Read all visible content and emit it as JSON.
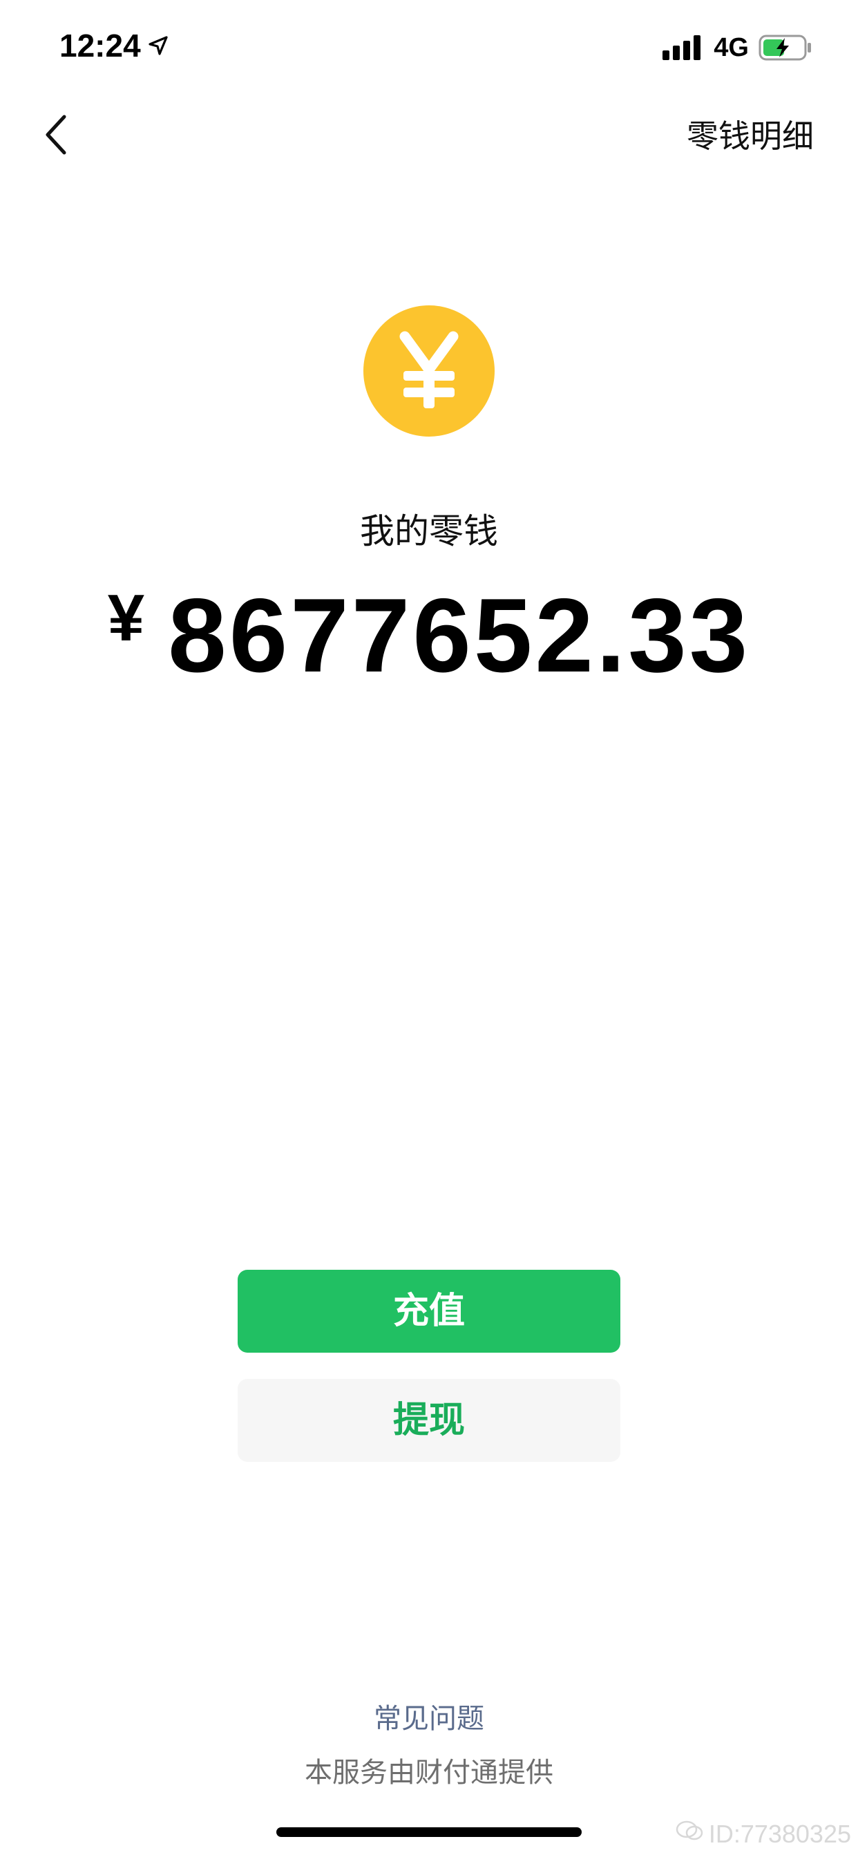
{
  "status_bar": {
    "time": "12:24",
    "network": "4G",
    "icons": [
      "location-arrow-icon",
      "signal-icon",
      "battery-charging-icon"
    ],
    "battery_color": "#34c759"
  },
  "nav": {
    "back_icon": "chevron-left-icon",
    "action_label": "零钱明细"
  },
  "wallet": {
    "icon": "yuan-coin-icon",
    "icon_color": "#fcc42e",
    "label": "我的零钱",
    "currency_symbol": "¥",
    "balance": "8677652.33"
  },
  "actions": {
    "recharge_label": "充值",
    "withdraw_label": "提现",
    "primary_color": "#21c063"
  },
  "footer": {
    "faq_label": "常见问题",
    "provider_note": "本服务由财付通提供"
  },
  "watermark": {
    "text": "ID:77380325"
  }
}
